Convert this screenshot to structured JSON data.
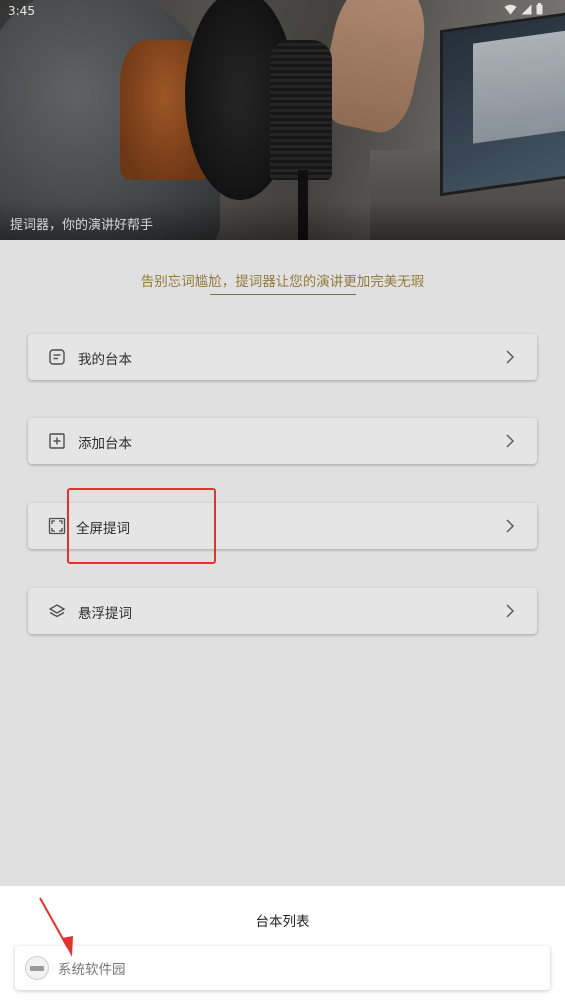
{
  "status_bar": {
    "time": "3:45"
  },
  "hero": {
    "caption": "提词器，你的演讲好帮手"
  },
  "tagline": "告别忘词尴尬，提词器让您的演讲更加完美无瑕",
  "menu": {
    "items": [
      {
        "label": "我的台本",
        "icon": "script-note-icon"
      },
      {
        "label": "添加台本",
        "icon": "add-square-icon"
      },
      {
        "label": "全屏提词",
        "icon": "fullscreen-icon"
      },
      {
        "label": "悬浮提词",
        "icon": "layers-icon"
      }
    ]
  },
  "bottom_sheet": {
    "title": "台本列表",
    "items": [
      {
        "name": "系统软件园"
      }
    ]
  },
  "annotation": {
    "highlight_color": "#e5322d"
  }
}
